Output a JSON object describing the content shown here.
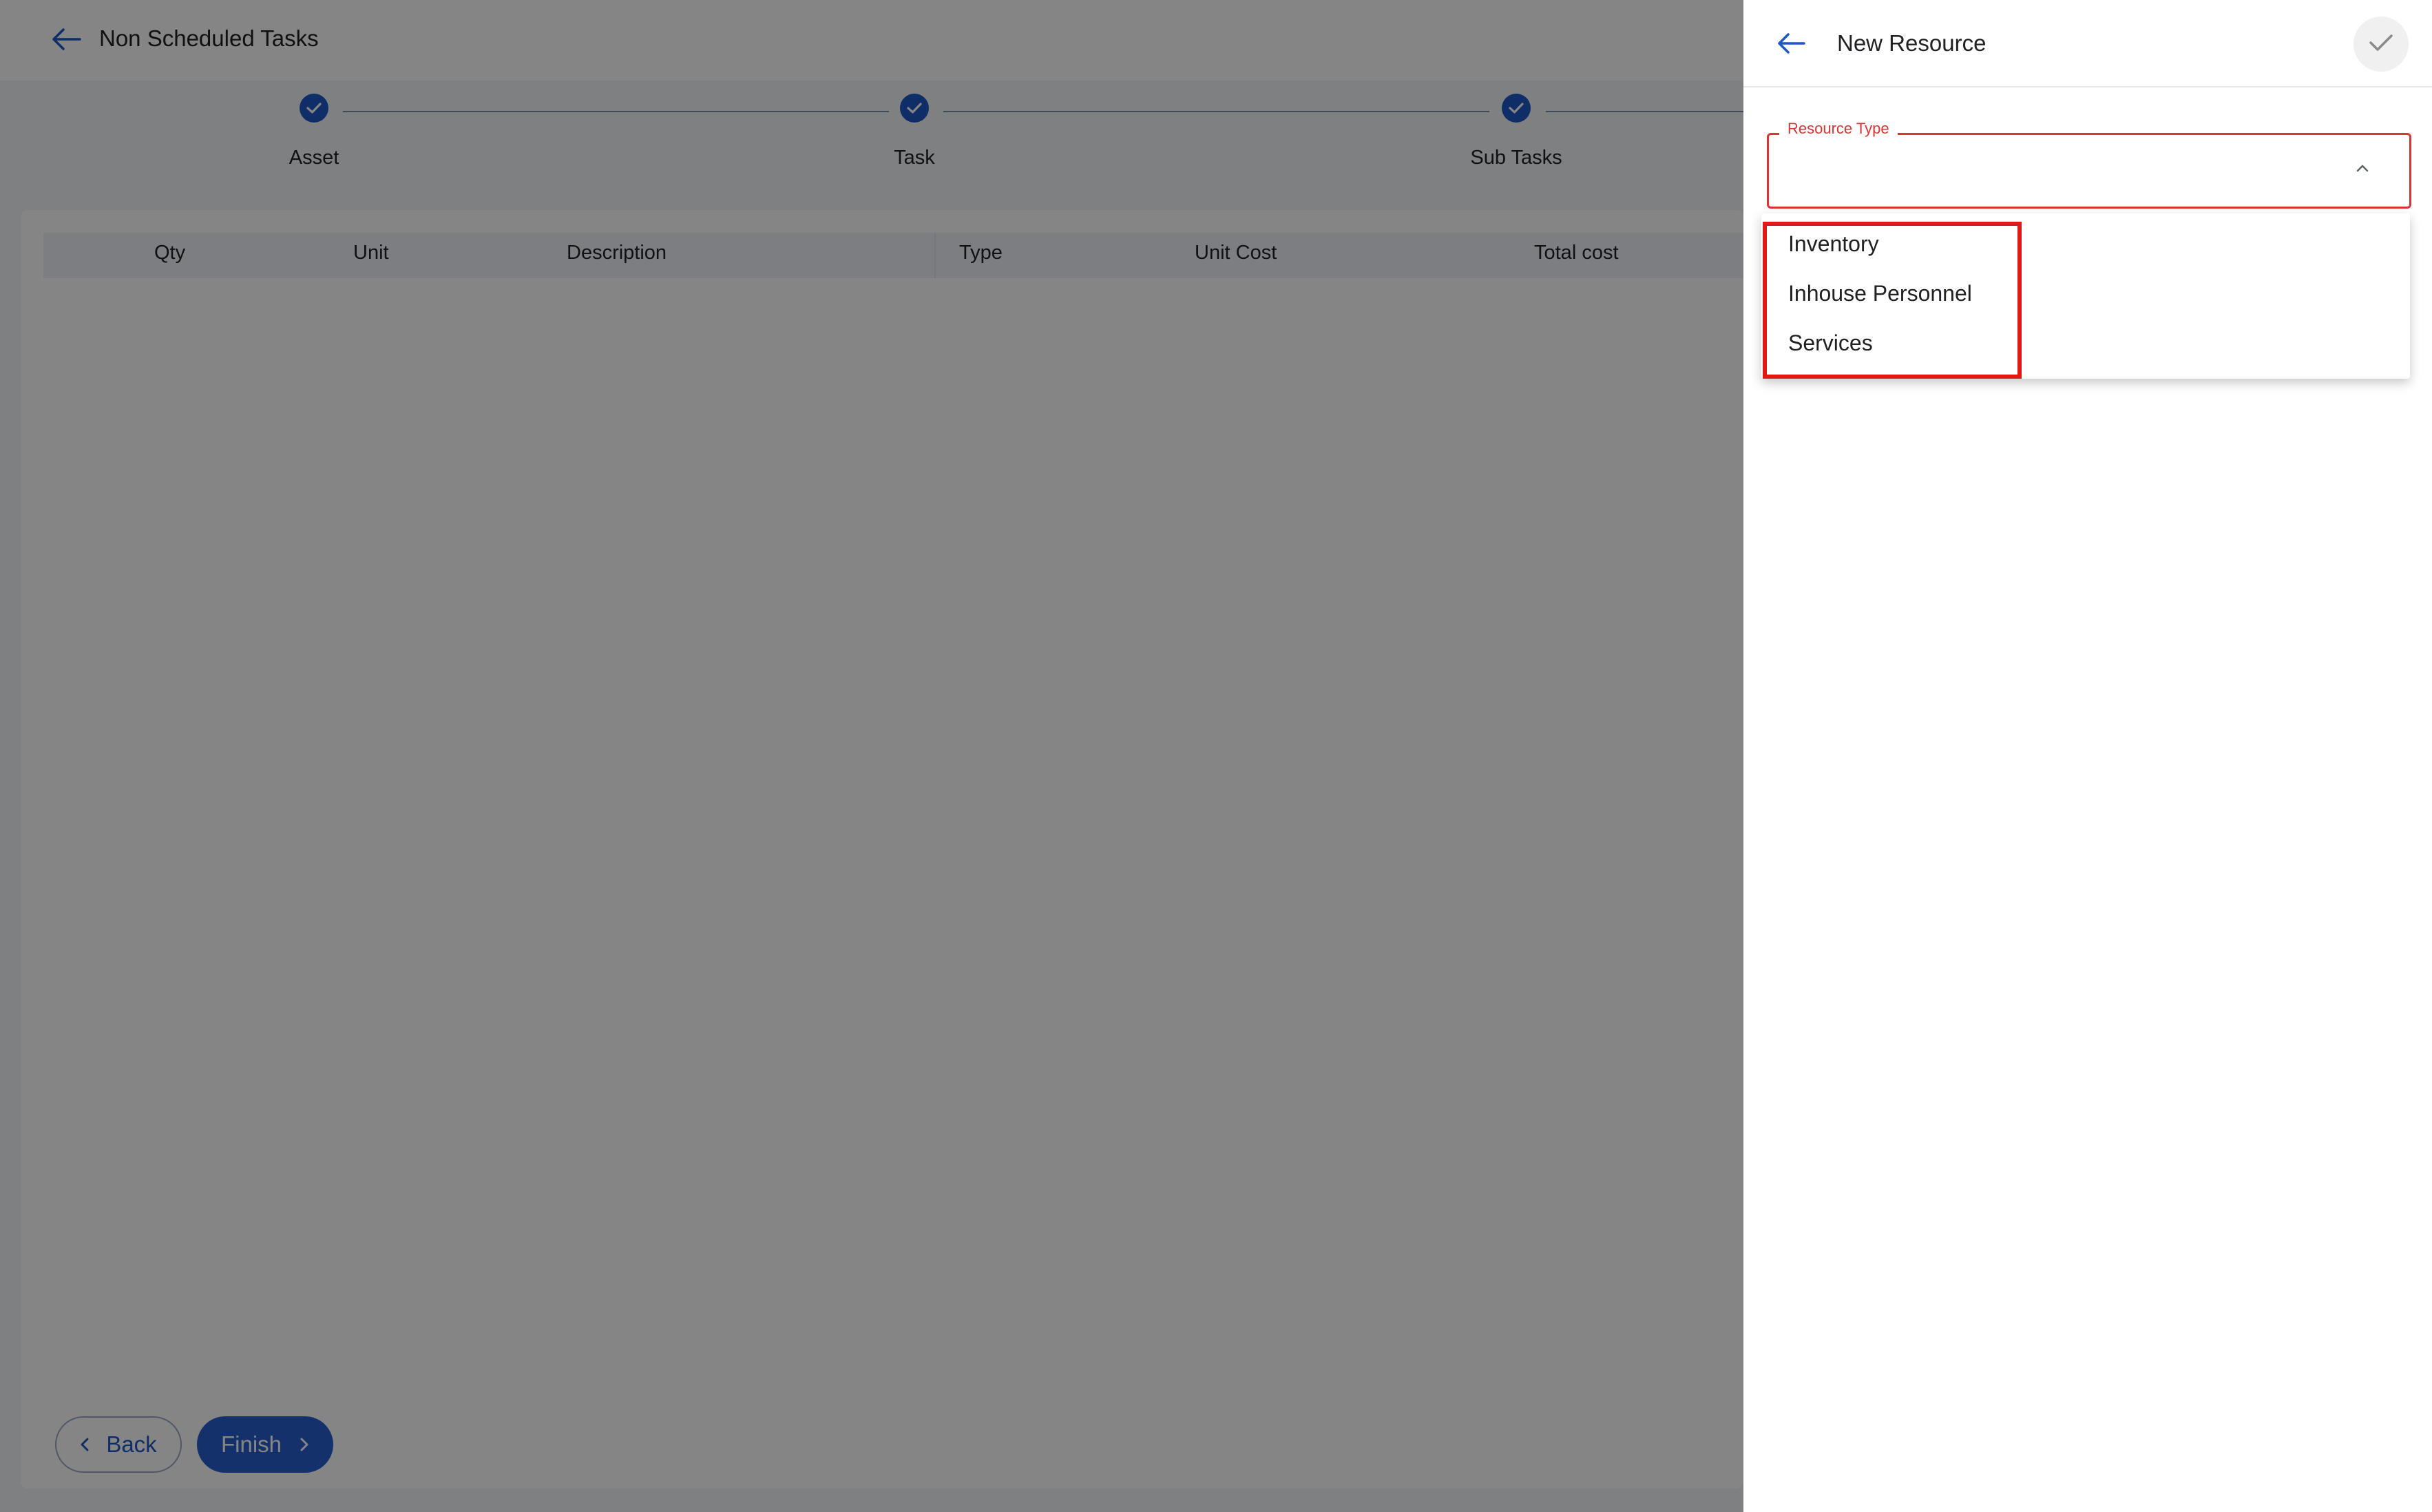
{
  "page": {
    "title": "Non Scheduled Tasks",
    "steps": [
      {
        "label": "Asset",
        "completed": true
      },
      {
        "label": "Task",
        "completed": true
      },
      {
        "label": "Sub Tasks",
        "completed": true
      }
    ],
    "table": {
      "columns": [
        "Qty",
        "Unit",
        "Description",
        "Type",
        "Unit Cost",
        "Total cost"
      ],
      "rows": []
    },
    "buttons": {
      "back_label": "Back",
      "finish_label": "Finish"
    }
  },
  "panel": {
    "title": "New Resource",
    "resource_type": {
      "label": "Resource Type",
      "value": "",
      "options": [
        "Inventory",
        "Inhouse Personnel",
        "Services"
      ]
    }
  },
  "colors": {
    "accent": "#1e56c4",
    "error": "#d93535",
    "highlight": "#e01818"
  },
  "icons": {
    "back": "arrow-left-icon",
    "step": "check-circle-icon",
    "confirm": "check-icon",
    "dropdown": "chevron-up-icon",
    "prev": "chevron-left-icon",
    "next": "chevron-right-icon"
  }
}
